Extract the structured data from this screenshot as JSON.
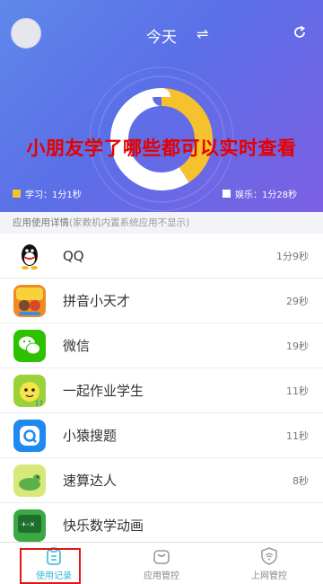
{
  "header": {
    "title": "今天",
    "swap_icon": "⇌",
    "icons": [
      "avatar",
      "swap-icon",
      "refresh-icon"
    ]
  },
  "overlay_text": "小朋友学了哪些都可以实时查看",
  "chart_data": {
    "type": "pie",
    "series": [
      {
        "name": "学习",
        "value_seconds": 61,
        "display": "1分1秒",
        "color": "#f5c12e"
      },
      {
        "name": "娱乐",
        "value_seconds": 88,
        "display": "1分28秒",
        "color": "#ffffff"
      }
    ]
  },
  "legend": {
    "study_label": "学习：",
    "study_value": "1分1秒",
    "fun_label": "娱乐：",
    "fun_value": "1分28秒"
  },
  "section_title": "应用使用详情",
  "section_note": "(家教机内置系统应用不显示)",
  "apps": [
    {
      "name": "QQ",
      "duration": "1分9秒",
      "icon": "qq-icon"
    },
    {
      "name": "拼音小天才",
      "duration": "29秒",
      "icon": "pinyin-app-icon"
    },
    {
      "name": "微信",
      "duration": "19秒",
      "icon": "wechat-icon"
    },
    {
      "name": "一起作业学生",
      "duration": "11秒",
      "icon": "homework-app-icon"
    },
    {
      "name": "小猿搜题",
      "duration": "11秒",
      "icon": "search-question-icon"
    },
    {
      "name": "速算达人",
      "duration": "8秒",
      "icon": "math-speed-icon"
    },
    {
      "name": "快乐数学动画",
      "duration": "",
      "icon": "math-animation-icon"
    }
  ],
  "tabs": [
    {
      "label": "使用记录",
      "icon": "clipboard-icon",
      "active": true
    },
    {
      "label": "应用管控",
      "icon": "bag-icon",
      "active": false
    },
    {
      "label": "上网管控",
      "icon": "wifi-shield-icon",
      "active": false
    }
  ]
}
